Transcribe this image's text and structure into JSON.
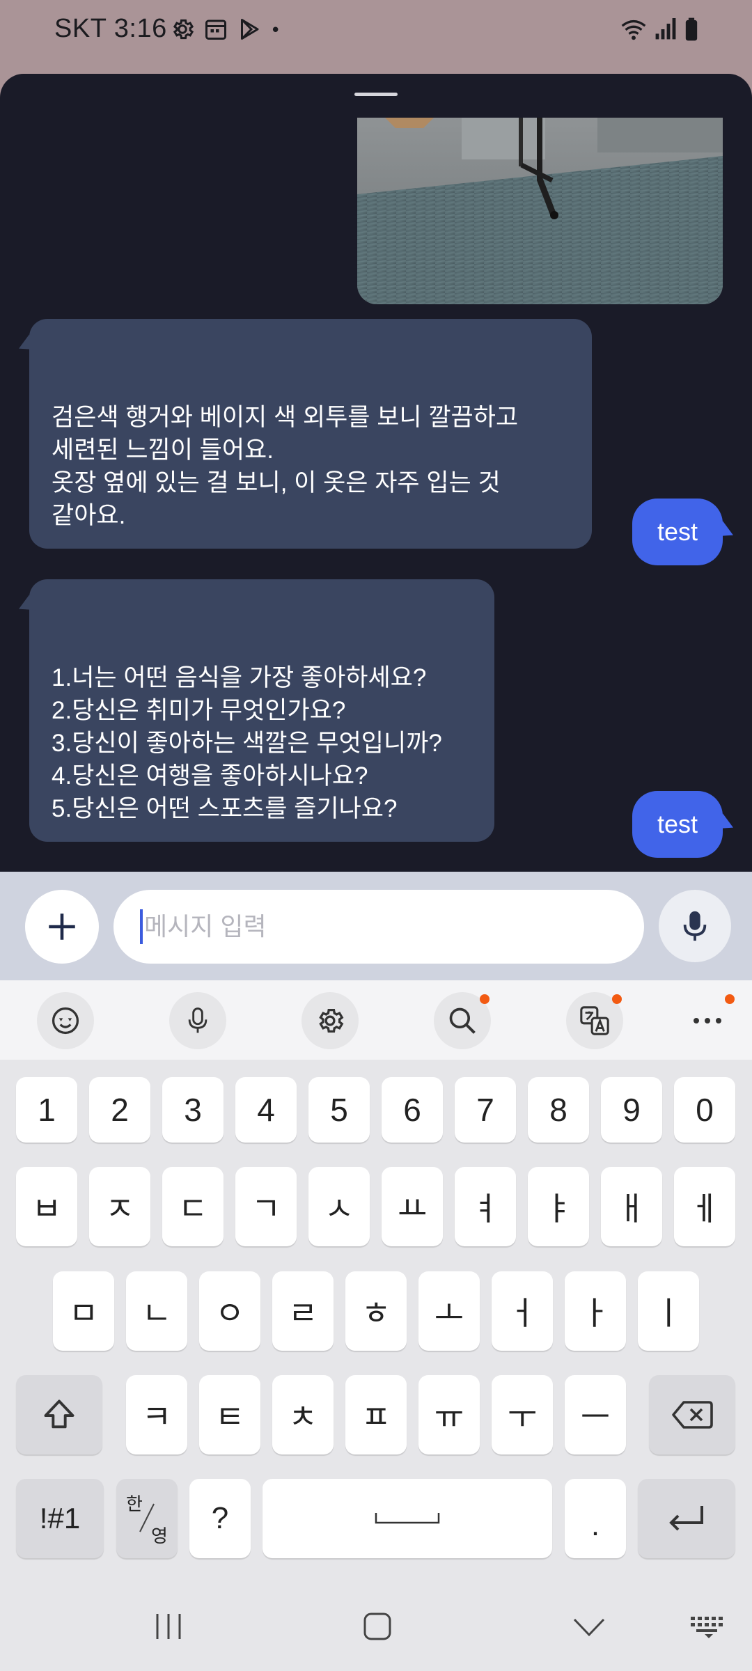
{
  "status_bar": {
    "carrier_time": "SKT 3:16",
    "dot": "•",
    "icons_left": [
      "settings-icon",
      "calendar-icon",
      "play-store-icon",
      "dot-icon"
    ],
    "icons_right": [
      "wifi-icon",
      "signal-icon",
      "battery-icon"
    ]
  },
  "chat": {
    "messages": [
      {
        "from": "bot",
        "text": "검은색 행거와 베이지 색 외투를 보니 깔끔하고\n세련된 느낌이 들어요.\n 옷장 옆에 있는 걸 보니, 이 옷은 자주 입는 것\n같아요."
      },
      {
        "from": "user",
        "text": "test"
      },
      {
        "from": "bot",
        "text": "1.너는 어떤 음식을 가장 좋아하세요?\n2.당신은 취미가 무엇인가요?\n3.당신이 좋아하는 색깔은 무엇입니까?\n4.당신은 여행을 좋아하시나요?\n5.당신은 어떤 스포츠를 즐기나요?"
      },
      {
        "from": "user",
        "text": "test"
      }
    ]
  },
  "input": {
    "placeholder": "메시지 입력",
    "value": ""
  },
  "keyboard": {
    "toolbar": [
      "emoji-sticker-icon",
      "voice-input-icon",
      "settings-icon",
      "search-icon",
      "translate-icon",
      "more-icon"
    ],
    "numbers": [
      "1",
      "2",
      "3",
      "4",
      "5",
      "6",
      "7",
      "8",
      "9",
      "0"
    ],
    "row1": [
      "ㅂ",
      "ㅈ",
      "ㄷ",
      "ㄱ",
      "ㅅ",
      "ㅛ",
      "ㅕ",
      "ㅑ",
      "ㅐ",
      "ㅔ"
    ],
    "row2": [
      "ㅁ",
      "ㄴ",
      "ㅇ",
      "ㄹ",
      "ㅎ",
      "ㅗ",
      "ㅓ",
      "ㅏ",
      "ㅣ"
    ],
    "row3": [
      "ㅋ",
      "ㅌ",
      "ㅊ",
      "ㅍ",
      "ㅠ",
      "ㅜ",
      "ㅡ"
    ],
    "symbols_label": "!#1",
    "lang_top": "한",
    "lang_bottom": "영",
    "question": "?",
    "period": "."
  },
  "colors": {
    "status_bg": "#aa9497",
    "sheet_bg": "#1a1b28",
    "bot_bubble": "#3a4560",
    "user_bubble": "#4164e9",
    "input_bar": "#cfd3df",
    "badge": "#f25a12"
  }
}
